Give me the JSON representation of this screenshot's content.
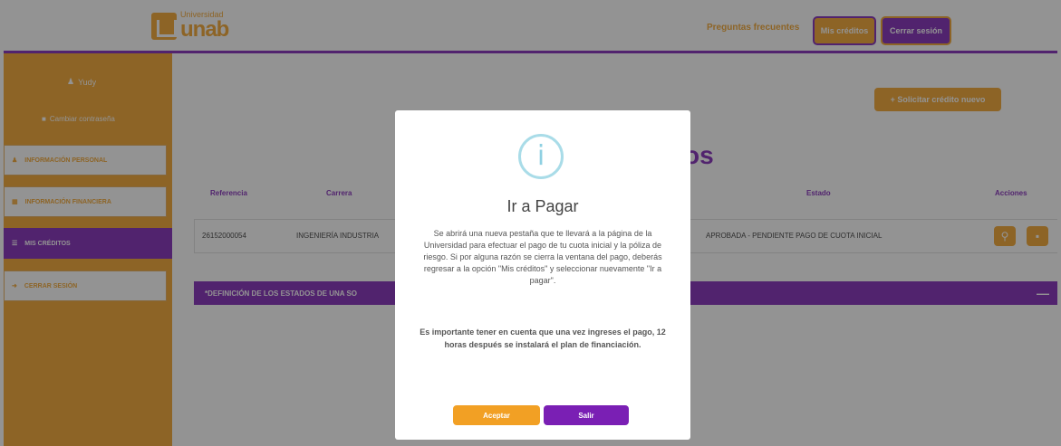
{
  "header": {
    "logo_small": "Universidad",
    "logo_big": "unab",
    "faq": "Preguntas frecuentes",
    "mis_creditos": "Mis créditos",
    "cerrar_sesion": "Cerrar sesión"
  },
  "sidebar": {
    "user": "Yudy",
    "change_password": "Cambiar contraseña",
    "items": [
      {
        "label": "Información personal",
        "icon": "user-icon"
      },
      {
        "label": "Información financiera",
        "icon": "document-icon"
      },
      {
        "label": "Mis créditos",
        "icon": "list-icon"
      },
      {
        "label": "Cerrar sesión",
        "icon": "logout-icon"
      }
    ]
  },
  "main": {
    "new_credit": "+ Solicitar crédito nuevo",
    "heading": "os",
    "columns": [
      "Referencia",
      "Carrera",
      "Estado",
      "Acciones"
    ],
    "row": {
      "reference": "26152000054",
      "career": "INGENIERÍA INDUSTRIA",
      "status": "APROBADA - PENDIENTE PAGO DE CUOTA INICIAL"
    },
    "definitions": "*DEFINICIÓN DE LOS ESTADOS DE UNA SO",
    "definitions_toggle": "—"
  },
  "modal": {
    "icon": "i",
    "title": "Ir a Pagar",
    "body": "Se abrirá una nueva pestaña que te llevará a la página de la Universidad para efectuar el pago de tu cuota inicial y la póliza de riesgo. Si por alguna razón se cierra la ventana del pago, deberás regresar a la opción \"Mis créditos\" y seleccionar nuevamente \"Ir a pagar\".",
    "note": "Es importante tener en cuenta que una vez ingreses el pago, 12 horas después se instalará el plan de financiación.",
    "accept": "Aceptar",
    "exit": "Salir"
  },
  "colors": {
    "accent_orange": "#f2a024",
    "accent_purple": "#7a1fb4"
  }
}
